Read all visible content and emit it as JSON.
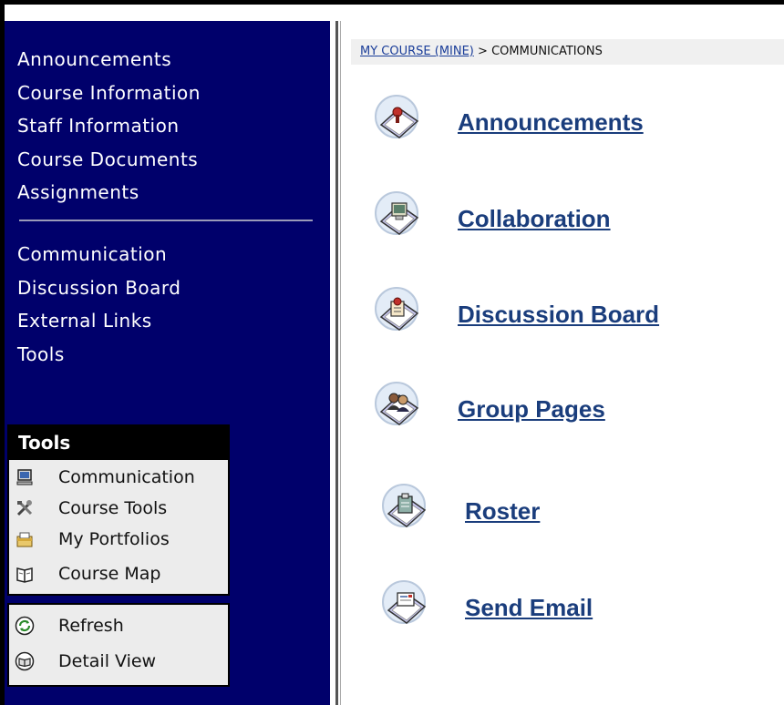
{
  "sidebar": {
    "nav_primary": [
      {
        "label": "Announcements"
      },
      {
        "label": "Course Information"
      },
      {
        "label": "Staff Information"
      },
      {
        "label": "Course Documents"
      },
      {
        "label": "Assignments"
      }
    ],
    "nav_secondary": [
      {
        "label": "Communication"
      },
      {
        "label": "Discussion Board"
      },
      {
        "label": "External Links"
      },
      {
        "label": "Tools"
      }
    ],
    "tools_panel": {
      "title": "Tools",
      "items": [
        {
          "label": "Communication",
          "icon": "computer-icon"
        },
        {
          "label": "Course Tools",
          "icon": "tools-icon"
        },
        {
          "label": "My Portfolios",
          "icon": "portfolio-icon"
        },
        {
          "label": "Course Map",
          "icon": "map-book-icon"
        }
      ]
    },
    "view_panel": {
      "items": [
        {
          "label": "Refresh",
          "icon": "refresh-icon"
        },
        {
          "label": "Detail View",
          "icon": "detail-view-icon"
        }
      ]
    }
  },
  "breadcrumb": {
    "course_link": "MY COURSE (MINE)",
    "separator": ">",
    "current": "COMMUNICATIONS"
  },
  "main": {
    "entries": [
      {
        "label": "Announcements",
        "icon": "announcements-icon"
      },
      {
        "label": "Collaboration",
        "icon": "collaboration-icon"
      },
      {
        "label": "Discussion Board",
        "icon": "discussion-board-icon"
      },
      {
        "label": "Group Pages",
        "icon": "group-pages-icon"
      },
      {
        "label": "Roster",
        "icon": "roster-icon"
      },
      {
        "label": "Send Email",
        "icon": "send-email-icon"
      }
    ]
  },
  "colors": {
    "sidebar_bg": "#00006b",
    "link": "#1a3d7c",
    "panel_bg": "#ececec"
  }
}
